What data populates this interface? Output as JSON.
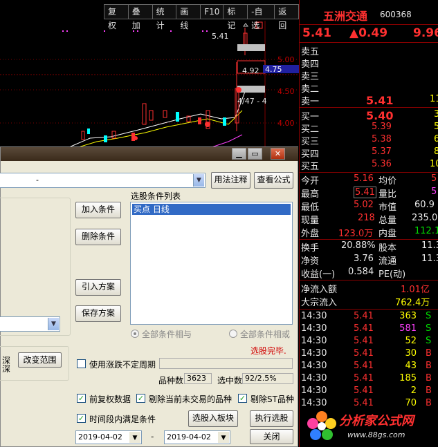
{
  "toolbar": {
    "items": [
      "复权",
      "叠加",
      "统计",
      "画线",
      "F10",
      "标记",
      "-自选",
      "返回"
    ]
  },
  "chart": {
    "price_labels": [
      "5.00",
      "4.50",
      "4.00"
    ],
    "high_label": "5.41",
    "line_label_left": "4.92",
    "line_label_right": "4.75",
    "low_label": "4/47 - 4",
    "colors": {
      "up": "#ff3030",
      "down": "#00ffff",
      "ma1": "#ffffff",
      "ma2": "#ffff00",
      "ma3": "#ff40ff",
      "grid": "#800000"
    }
  },
  "quote": {
    "name": "五洲交通",
    "code": "600368",
    "price": "5.41",
    "change": "▲0.49",
    "change_pct": "9.96",
    "sell": [
      {
        "label": "卖五",
        "price": "",
        "vol": ""
      },
      {
        "label": "卖四",
        "price": "",
        "vol": ""
      },
      {
        "label": "卖三",
        "price": "",
        "vol": ""
      },
      {
        "label": "卖二",
        "price": "",
        "vol": ""
      },
      {
        "label": "卖一",
        "price": "5.41",
        "vol": "11"
      }
    ],
    "buy": [
      {
        "label": "买一",
        "price": "5.40",
        "vol": "3"
      },
      {
        "label": "买二",
        "price": "5.39",
        "vol": "5"
      },
      {
        "label": "买三",
        "price": "5.38",
        "vol": "6"
      },
      {
        "label": "买四",
        "price": "5.37",
        "vol": "8"
      },
      {
        "label": "买五",
        "price": "5.36",
        "vol": "10"
      }
    ],
    "stats": [
      {
        "l1": "今开",
        "v1": "5.16",
        "l2": "均价",
        "v2": "5"
      },
      {
        "l1": "最高",
        "v1": "5.41",
        "l2": "量比",
        "v2": "5"
      },
      {
        "l1": "最低",
        "v1": "5.02",
        "l2": "市值",
        "v2": "60.9"
      },
      {
        "l1": "现量",
        "v1": "218",
        "l2": "总量",
        "v2": "235.0"
      },
      {
        "l1": "外盘",
        "v1": "123.0万",
        "l2": "内盘",
        "v2": "112.1"
      }
    ],
    "stats2": [
      {
        "l1": "换手",
        "v1": "20.88%",
        "l2": "股本",
        "v2": "11.3"
      },
      {
        "l1": "净资",
        "v1": "3.76",
        "l2": "流通",
        "v2": "11.3"
      },
      {
        "l1": "收益(一)",
        "v1": "0.584",
        "l2": "PE(动)",
        "v2": ""
      }
    ],
    "flow": [
      {
        "label": "净流入额",
        "value": "1.01亿"
      },
      {
        "label": "大宗流入",
        "value": "762.4万"
      }
    ],
    "ticks": [
      {
        "time": "14:30",
        "price": "5.41",
        "vol": "363",
        "side": "S",
        "volColor": "yellow"
      },
      {
        "time": "14:30",
        "price": "5.41",
        "vol": "581",
        "side": "S",
        "volColor": "purple"
      },
      {
        "time": "14:30",
        "price": "5.41",
        "vol": "52",
        "side": "S",
        "volColor": "yellow"
      },
      {
        "time": "14:30",
        "price": "5.41",
        "vol": "30",
        "side": "B",
        "volColor": "yellow"
      },
      {
        "time": "14:30",
        "price": "5.41",
        "vol": "43",
        "side": "B",
        "volColor": "yellow"
      },
      {
        "time": "14:30",
        "price": "5.41",
        "vol": "185",
        "side": "B",
        "volColor": "yellow"
      },
      {
        "time": "14:30",
        "price": "5.41",
        "vol": "2",
        "side": "B",
        "volColor": "yellow"
      },
      {
        "time": "14:30",
        "price": "5.41",
        "vol": "70",
        "side": "B",
        "volColor": "yellow"
      }
    ]
  },
  "dialog": {
    "formula_select": "-",
    "usage_button": "用法注释",
    "view_formula_button": "查看公式",
    "cond_list_label": "选股条件列表",
    "cond_item": "买点  日线",
    "add_cond": "加入条件",
    "delete_cond": "删除条件",
    "import_plan": "引入方案",
    "save_plan": "保存方案",
    "all_and": "全部条件相与",
    "all_or": "全部条件相或",
    "status": "选股完毕.",
    "range_label_1": "深",
    "range_label_2": "深",
    "change_range": "改变范围",
    "use_period": "使用涨跌不定周期",
    "species_label": "品种数",
    "species_value": "3623",
    "selected_label": "选中数",
    "selected_value": "92/2.5%",
    "pre_adjust": "前复权数据",
    "exclude_untraded": "剔除当前未交易的品种",
    "exclude_st": "剔除ST品种",
    "time_range": "时间段内满足条件",
    "to_block": "选股入板块",
    "execute": "执行选股",
    "date_from": "2019-04-02",
    "date_sep": "-",
    "date_to": "2019-04-02",
    "close": "关闭"
  },
  "logo": {
    "name": "分析家公式网",
    "url": "www.88gs.com"
  }
}
